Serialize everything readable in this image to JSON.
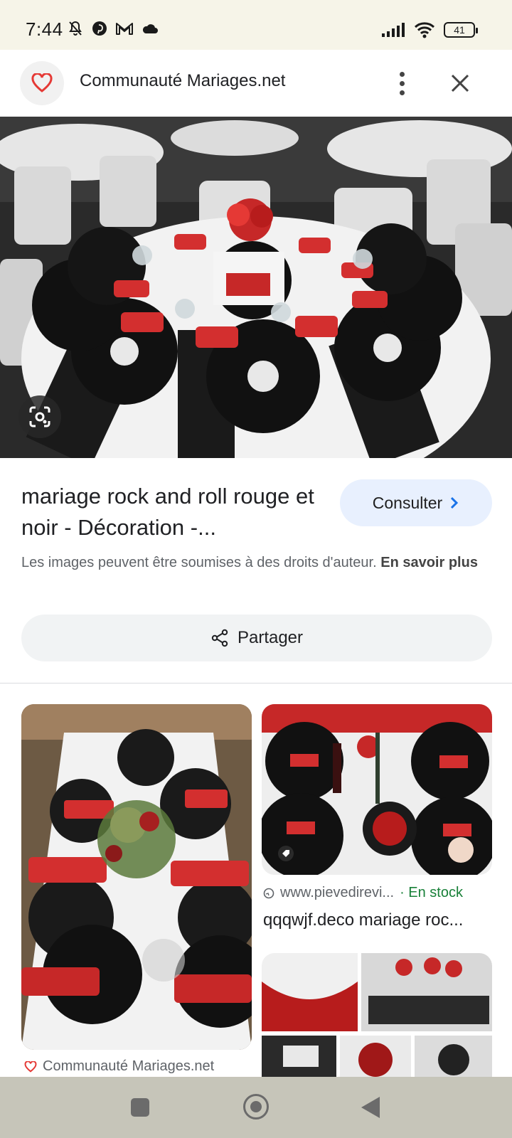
{
  "status_bar": {
    "time": "7:44",
    "battery": "41",
    "left_icons": [
      "muted-bell-icon",
      "pinterest-icon",
      "gmail-icon",
      "cloud-icon"
    ],
    "right_icons": [
      "signal-icon",
      "wifi-icon",
      "battery-icon"
    ]
  },
  "header": {
    "site_name": "Communauté Mariages.net",
    "icons": [
      "heart-logo-icon",
      "more-vert-icon",
      "close-icon"
    ]
  },
  "result": {
    "title": "mariage rock and roll rouge et noir - Décoration -...",
    "consult_label": "Consulter",
    "copyright_text": "Les images peuvent être soumises à des droits d'auteur.",
    "learn_more": "En savoir plus",
    "share_label": "Partager"
  },
  "related": {
    "card2_source": "www.pievedirevi...",
    "card2_stock": "· En stock",
    "card2_caption": "qqqwjf.deco mariage roc...",
    "card1_source": "Communauté Mariages.net"
  },
  "colors": {
    "accent_red": "#e53935",
    "consult_bg": "#e8f0fe",
    "stock_green": "#188038",
    "status_bar_bg": "#f6f4e8",
    "nav_bar_bg": "#c6c5b9"
  }
}
